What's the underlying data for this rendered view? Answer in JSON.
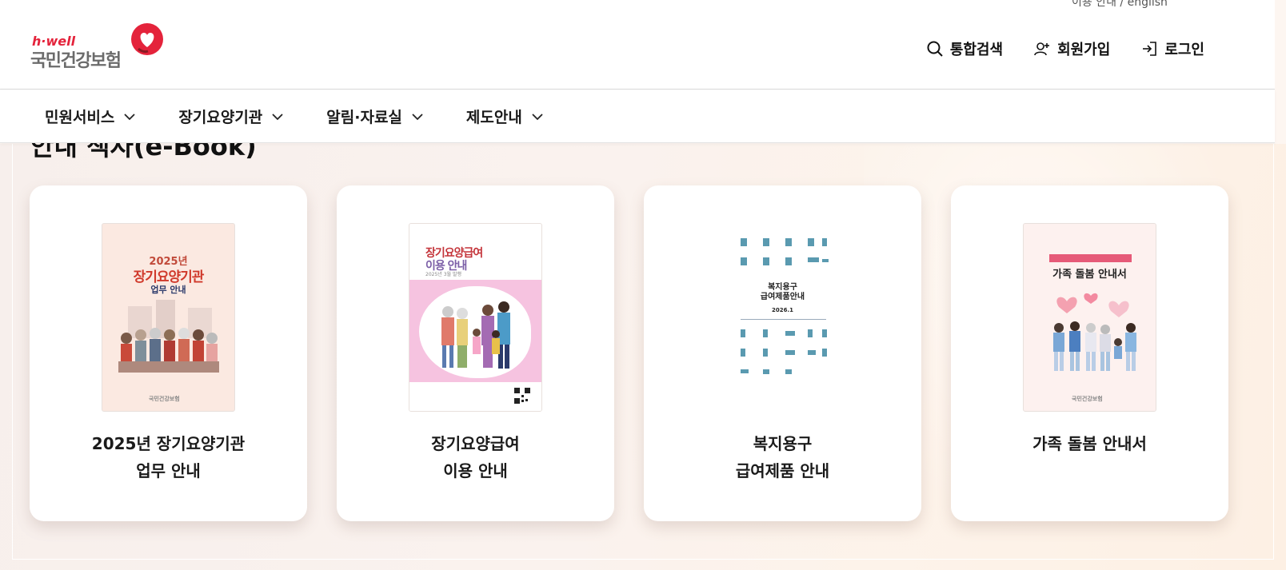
{
  "header": {
    "logo_brand": "h·well",
    "logo_name": "국민건강보험",
    "cut_text": "이용 안내 / english",
    "utils": [
      {
        "label": "통합검색",
        "icon": "search-icon"
      },
      {
        "label": "회원가입",
        "icon": "user-add-icon"
      },
      {
        "label": "로그인",
        "icon": "login-icon"
      }
    ]
  },
  "nav": {
    "items": [
      {
        "label": "민원서비스"
      },
      {
        "label": "장기요양기관"
      },
      {
        "label": "알림·자료실"
      },
      {
        "label": "제도안내"
      }
    ]
  },
  "section": {
    "title": "안내 책자(e-Book)"
  },
  "cards": [
    {
      "title_line1": "2025년 장기요양기관",
      "title_line2": "업무 안내",
      "thumb": {
        "year": "2025년",
        "title": "장기요양기관",
        "sub": "업무 안내",
        "footer": "국민건강보험"
      }
    },
    {
      "title_line1": "장기요양급여",
      "title_line2": "이용 안내",
      "thumb": {
        "title1": "장기요양급여",
        "title2": "이용 안내",
        "date": "2025년 3월 발행"
      }
    },
    {
      "title_line1": "복지용구",
      "title_line2": "급여제품 안내",
      "thumb": {
        "title1": "복지용구",
        "title2": "급여제품안내",
        "date": "2026.1"
      }
    },
    {
      "title_line1": "가족 돌봄 안내서",
      "title_line2": "",
      "thumb": {
        "title": "가족 돌봄 안내서",
        "footer": "국민건강보험"
      }
    }
  ],
  "colors": {
    "brand_red": "#e4233b",
    "text": "#1a1a1a"
  }
}
